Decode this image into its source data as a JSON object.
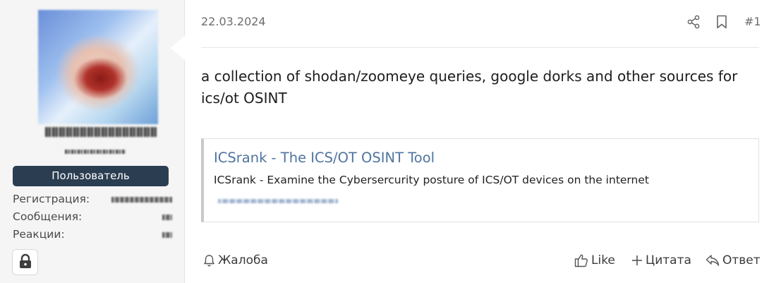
{
  "user": {
    "role_badge": "Пользователь",
    "stats": [
      {
        "label": "Регистрация:"
      },
      {
        "label": "Сообщения:"
      },
      {
        "label": "Реакции:"
      }
    ]
  },
  "post": {
    "date": "22.03.2024",
    "number": "#1",
    "body": "a collection of shodan/zoomeye queries, google dorks and other sources for ics/ot OSINT",
    "embed": {
      "title": "ICSrank - The ICS/OT OSINT Tool",
      "description": "ICSrank - Examine the Cybersercurity posture of ICS/OT devices on the internet"
    }
  },
  "actions": {
    "report": "Жалоба",
    "like": "Like",
    "quote": "Цитата",
    "reply": "Ответ"
  },
  "icons": {
    "header": [
      "share-icon",
      "bookmark-icon"
    ],
    "actions": [
      "bell-icon",
      "thumbs-up-icon",
      "plus-icon",
      "reply-icon"
    ],
    "user": [
      "lock-icon"
    ]
  },
  "colors": {
    "role_badge_bg": "#2b3d51",
    "embed_link": "#4f74a0",
    "sidebar_bg": "#f5f5f5"
  }
}
